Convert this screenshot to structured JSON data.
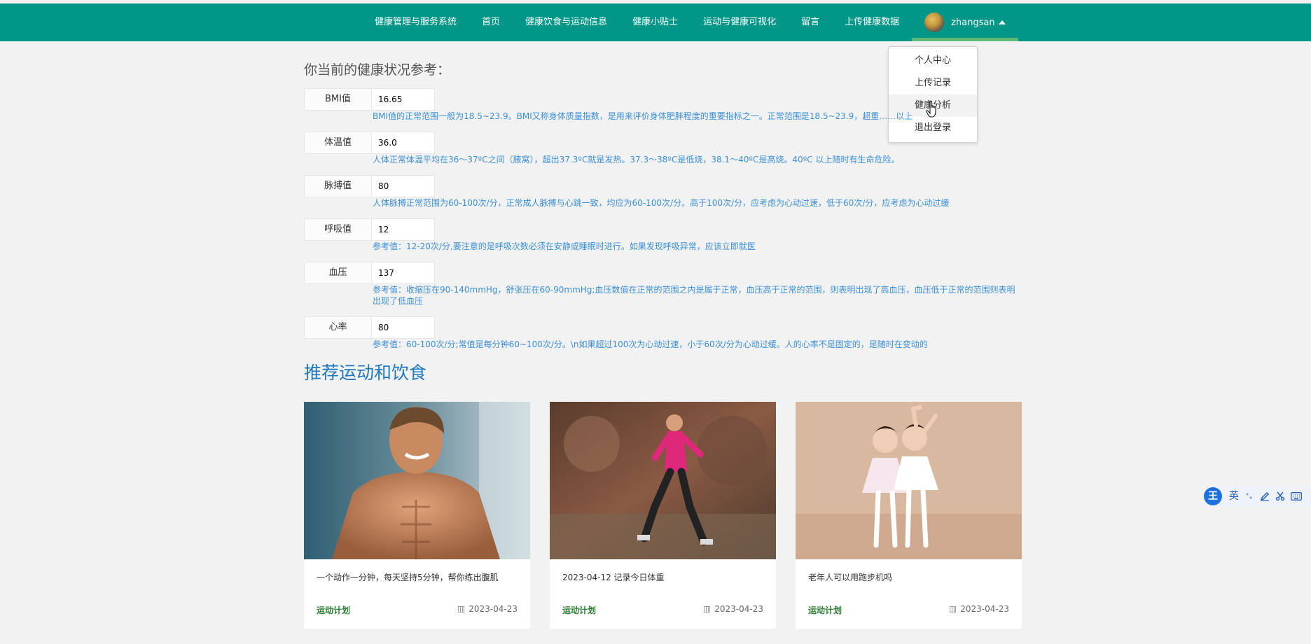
{
  "nav": {
    "brand": "健康管理与服务系统",
    "items": [
      "首页",
      "健康饮食与运动信息",
      "健康小贴士",
      "运动与健康可视化",
      "留言",
      "上传健康数据"
    ],
    "username": "zhangsan"
  },
  "dropdown": {
    "items": [
      "个人中心",
      "上传记录",
      "健康分析",
      "退出登录"
    ]
  },
  "health": {
    "title": "你当前的健康状况参考：",
    "metrics": [
      {
        "label": "BMI值",
        "value": "16.65",
        "desc": "BMI值的正常范围一般为18.5~23.9。BMI又称身体质量指数，是用来评价身体肥胖程度的重要指标之一。正常范围是18.5~23.9，超重……以上"
      },
      {
        "label": "体温值",
        "value": "36.0",
        "desc": "人体正常体温平均在36～37ºC之间（腋窝），超出37.3ºC就是发热。37.3～38ºC是低烧，38.1～40ºC是高烧。40ºC 以上随时有生命危险。"
      },
      {
        "label": "脉搏值",
        "value": "80",
        "desc": "人体脉搏正常范围为60-100次/分，正常成人脉搏与心跳一致，均应为60-100次/分。高于100次/分，应考虑为心动过速，低于60次/分，应考虑为心动过缓"
      },
      {
        "label": "呼吸值",
        "value": "12",
        "desc": "参考值：12-20次/分,要注意的是呼吸次数必须在安静或睡眠时进行。如果发现呼吸异常，应该立即就医"
      },
      {
        "label": "血压",
        "value": "137",
        "desc": "参考值：收缩压在90-140mmHg，舒张压在60-90mmHg;血压数值在正常的范围之内是属于正常，血压高于正常的范围，则表明出现了高血压，血压低于正常的范围则表明出现了低血压"
      },
      {
        "label": "心率",
        "value": "80",
        "desc": "参考值：60-100次/分;常值是每分钟60~100次/分。\\n如果超过100次为心动过速，小于60次/分为心动过缓。人的心率不是固定的，是随时在变动的"
      }
    ]
  },
  "recommend": {
    "title": "推荐运动和饮食",
    "cards": [
      {
        "title": "一个动作一分钟，每天坚持5分钟，帮你练出腹肌",
        "tag": "运动计划",
        "date": "2023-04-23"
      },
      {
        "title": "2023-04-12 记录今日体重",
        "tag": "运动计划",
        "date": "2023-04-23"
      },
      {
        "title": "老年人可以用跑步机吗",
        "tag": "运动计划",
        "date": "2023-04-23"
      }
    ]
  },
  "ime": {
    "logo": "王",
    "lang": "英",
    "icons": [
      "punctuation-icon",
      "pen-icon",
      "scissors-icon",
      "keyboard-icon"
    ]
  },
  "colors": {
    "nav_bg": "#009688",
    "nav_underline": "#5FB878",
    "desc_text": "#3b8fd9",
    "rec_title": "#1e78c0",
    "tag_text": "#2e7d32"
  }
}
